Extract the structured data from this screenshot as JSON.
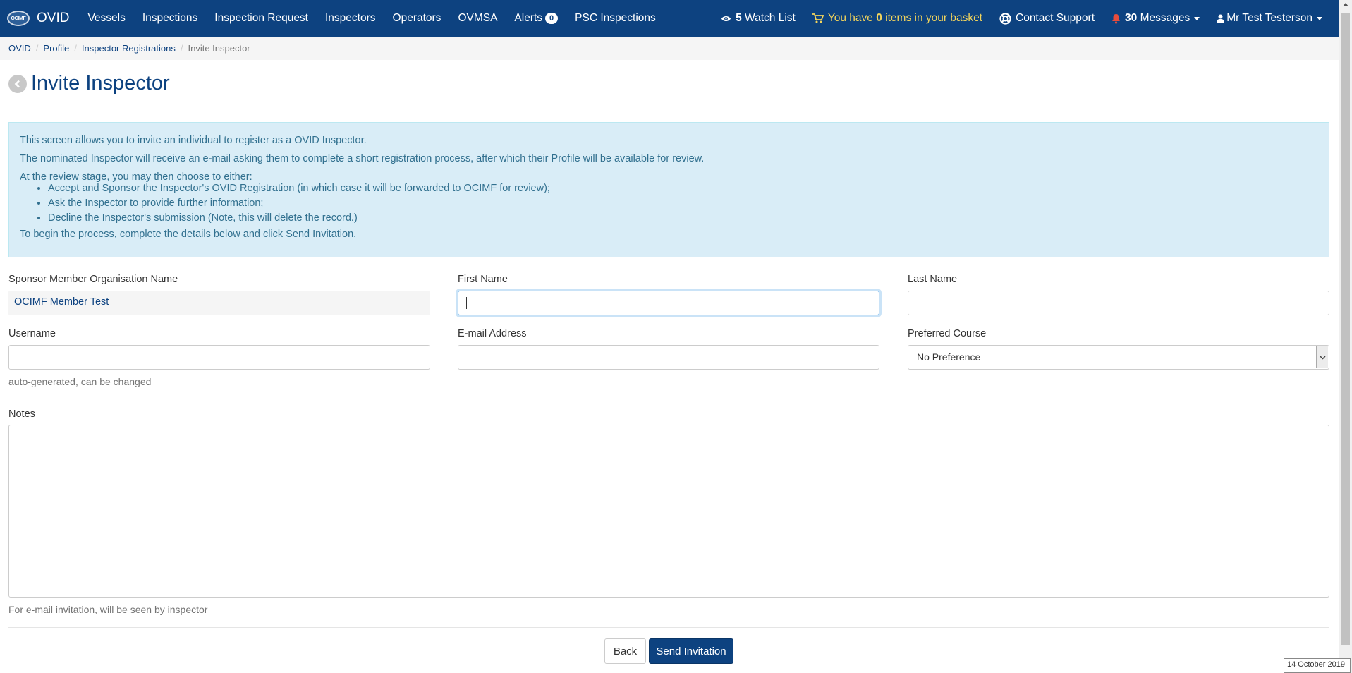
{
  "nav": {
    "logo_text": "OCIMF",
    "brand": "OVID",
    "items": [
      "Vessels",
      "Inspections",
      "Inspection Request",
      "Inspectors",
      "Operators",
      "OVMSA"
    ],
    "alerts_label": "Alerts",
    "alerts_count": "0",
    "psc": "PSC Inspections",
    "watch_count": "5",
    "watch_label": "Watch List",
    "basket_prefix": "You have",
    "basket_count": "0",
    "basket_suffix": "items in your basket",
    "support": "Contact Support",
    "messages_count": "30",
    "messages_label": "Messages",
    "user": "Mr Test Testerson"
  },
  "breadcrumb": {
    "items": [
      "OVID",
      "Profile",
      "Inspector Registrations"
    ],
    "active": "Invite Inspector"
  },
  "page": {
    "title": "Invite Inspector"
  },
  "info": {
    "p1": "This screen allows you to invite an individual to register as a OVID Inspector.",
    "p2": "The nominated Inspector will receive an e-mail asking them to complete a short registration process, after which their Profile will be available for review.",
    "p3": "At the review stage, you may then choose to either:",
    "bullets": [
      "Accept and Sponsor the Inspector's OVID Registration (in which case it will be forwarded to OCIMF for review);",
      "Ask the Inspector to provide further information;",
      "Decline the Inspector's submission (Note, this will delete the record.)"
    ],
    "p4": "To begin the process, complete the details below and click Send Invitation."
  },
  "form": {
    "sponsor_label": "Sponsor Member Organisation Name",
    "sponsor_value": "OCIMF Member Test",
    "first_name_label": "First Name",
    "first_name_value": "",
    "last_name_label": "Last Name",
    "last_name_value": "",
    "username_label": "Username",
    "username_value": "",
    "username_help": "auto-generated, can be changed",
    "email_label": "E-mail Address",
    "email_value": "",
    "course_label": "Preferred Course",
    "course_value": "No Preference",
    "notes_label": "Notes",
    "notes_help": "For e-mail invitation, will be seen by inspector"
  },
  "buttons": {
    "back": "Back",
    "send": "Send Invitation"
  },
  "footer": {
    "date": "14 October 2019"
  }
}
